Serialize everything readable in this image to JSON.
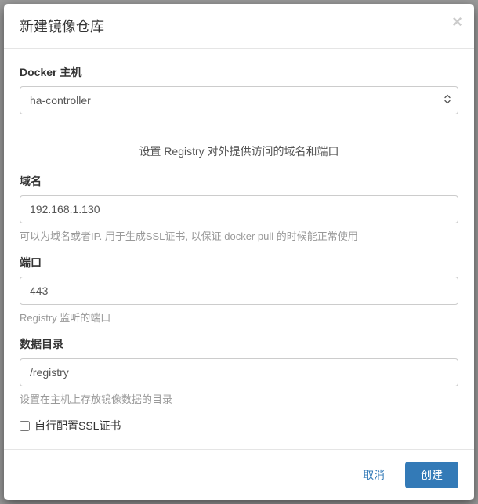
{
  "modal": {
    "title": "新建镜像仓库",
    "close_glyph": "×"
  },
  "form": {
    "docker_host": {
      "label": "Docker 主机",
      "value": "ha-controller"
    },
    "section_desc": "设置 Registry 对外提供访问的域名和端口",
    "domain": {
      "label": "域名",
      "value": "192.168.1.130",
      "help": "可以为域名或者IP. 用于生成SSL证书, 以保证 docker pull 的时候能正常使用"
    },
    "port": {
      "label": "端口",
      "value": "443",
      "help": "Registry 监听的端口"
    },
    "data_dir": {
      "label": "数据目录",
      "value": "/registry",
      "help": "设置在主机上存放镜像数据的目录"
    },
    "ssl_checkbox": {
      "label": "自行配置SSL证书"
    }
  },
  "footer": {
    "cancel": "取消",
    "create": "创建"
  }
}
